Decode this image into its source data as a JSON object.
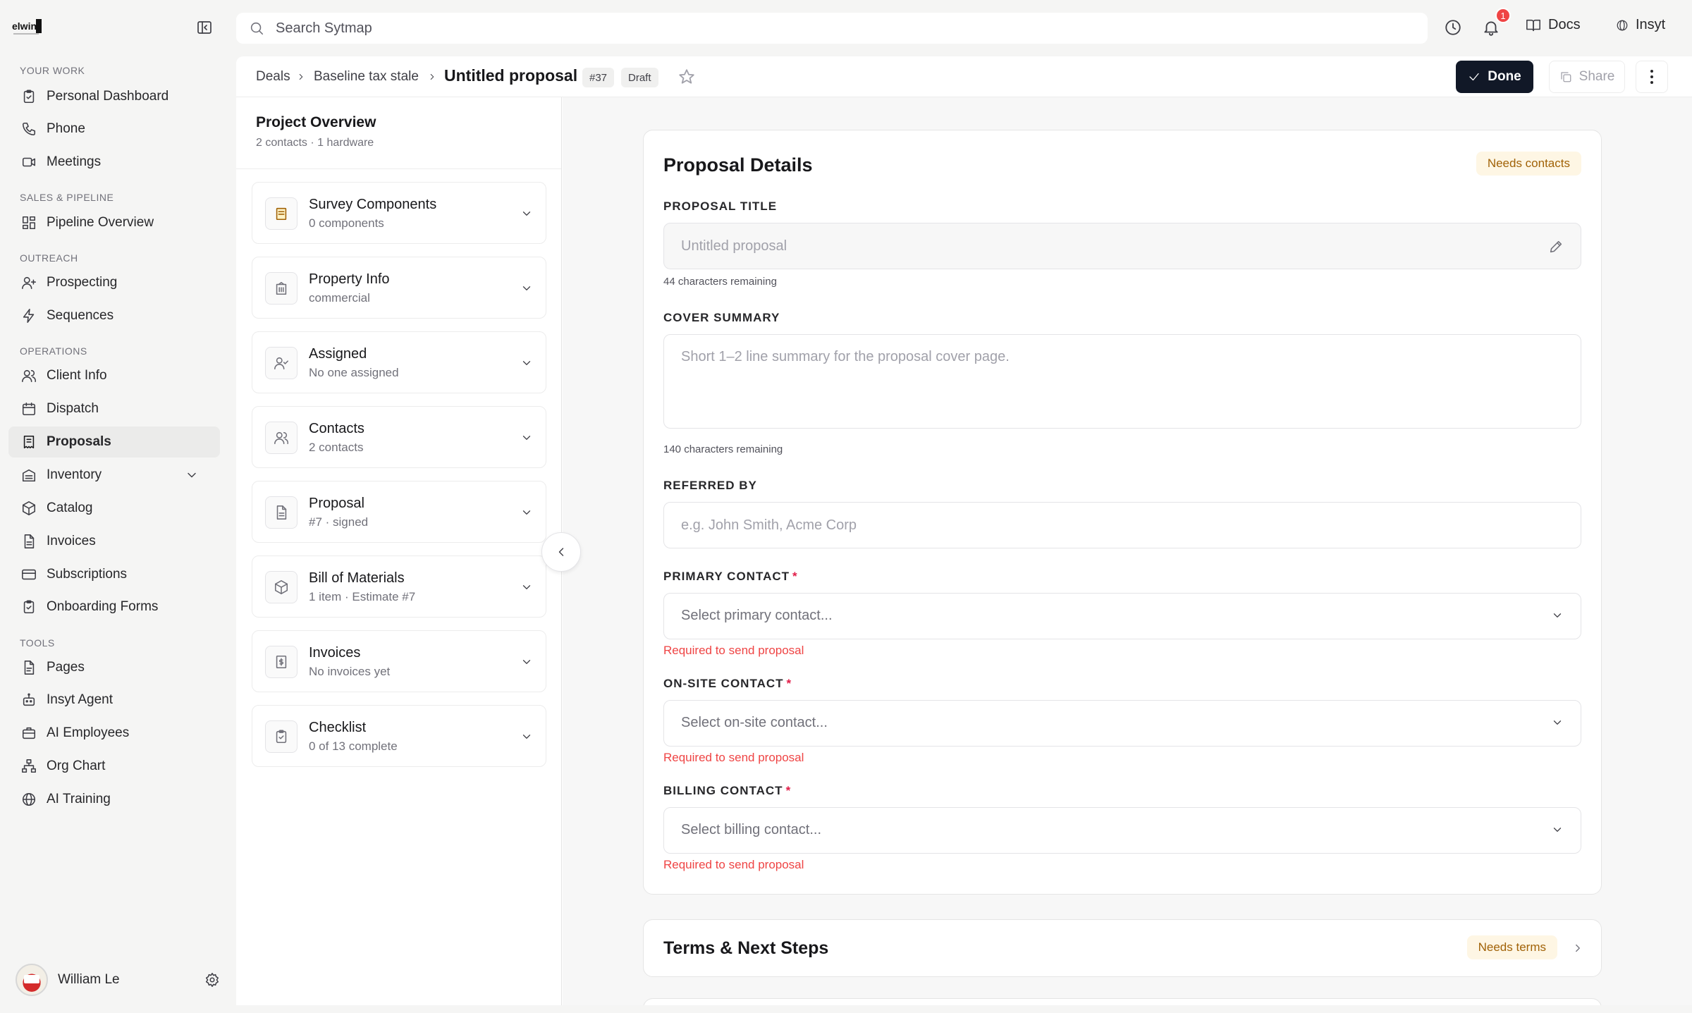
{
  "app": {
    "logo_text": "elwin"
  },
  "sidebar": {
    "sections": [
      {
        "label": "YOUR WORK"
      },
      {
        "label": "SALES & PIPELINE"
      },
      {
        "label": "OUTREACH"
      },
      {
        "label": "OPERATIONS"
      },
      {
        "label": "TOOLS"
      }
    ],
    "items": [
      {
        "label": "Personal Dashboard",
        "icon": "clipboard-icon"
      },
      {
        "label": "Phone",
        "icon": "phone-icon"
      },
      {
        "label": "Meetings",
        "icon": "video-icon"
      },
      {
        "label": "Pipeline Overview",
        "icon": "grid-icon"
      },
      {
        "label": "Prospecting",
        "icon": "user-plus-icon"
      },
      {
        "label": "Sequences",
        "icon": "lightning-icon"
      },
      {
        "label": "Client Info",
        "icon": "users-icon"
      },
      {
        "label": "Dispatch",
        "icon": "calendar-icon"
      },
      {
        "label": "Proposals",
        "icon": "receipt-icon"
      },
      {
        "label": "Inventory",
        "icon": "warehouse-icon"
      },
      {
        "label": "Catalog",
        "icon": "box-icon"
      },
      {
        "label": "Invoices",
        "icon": "document-icon"
      },
      {
        "label": "Subscriptions",
        "icon": "card-icon"
      },
      {
        "label": "Onboarding Forms",
        "icon": "clipboard-check-icon"
      },
      {
        "label": "Pages",
        "icon": "pages-icon"
      },
      {
        "label": "Insyt Agent",
        "icon": "robot-icon"
      },
      {
        "label": "AI Employees",
        "icon": "briefcase-icon"
      },
      {
        "label": "Org Chart",
        "icon": "org-chart-icon"
      },
      {
        "label": "AI Training",
        "icon": "globe-icon"
      }
    ],
    "active_item": "Proposals",
    "user": {
      "name": "William Le"
    }
  },
  "topbar": {
    "search_placeholder": "Search Sytmap",
    "notification_count": "1",
    "docs_label": "Docs",
    "insyt_label": "Insyt"
  },
  "header": {
    "breadcrumb": [
      "Deals",
      "Baseline tax stale"
    ],
    "title": "Untitled proposal",
    "number": "#37",
    "status": "Draft",
    "done_label": "Done",
    "share_label": "Share"
  },
  "panel": {
    "title": "Project Overview",
    "subtitle": "2 contacts · 1 hardware",
    "sections": [
      {
        "title": "Survey Components",
        "subtitle": "0 components",
        "icon": "survey-icon"
      },
      {
        "title": "Property Info",
        "subtitle": "commercial",
        "icon": "building-icon"
      },
      {
        "title": "Assigned",
        "subtitle": "No one assigned",
        "icon": "user-check-icon"
      },
      {
        "title": "Contacts",
        "subtitle": "2 contacts",
        "icon": "users-icon"
      },
      {
        "title": "Proposal",
        "subtitle": "#7 · signed",
        "icon": "document-icon"
      },
      {
        "title": "Bill of Materials",
        "subtitle": "1 item · Estimate #7",
        "icon": "package-icon"
      },
      {
        "title": "Invoices",
        "subtitle": "No invoices yet",
        "icon": "invoice-icon"
      },
      {
        "title": "Checklist",
        "subtitle": "0 of 13 complete",
        "icon": "checklist-icon"
      }
    ]
  },
  "form": {
    "title": "Proposal Details",
    "status_tag": "Needs contacts",
    "proposal_title": {
      "label": "PROPOSAL TITLE",
      "placeholder": "Untitled proposal",
      "hint": "44 characters remaining"
    },
    "cover_summary": {
      "label": "COVER SUMMARY",
      "placeholder": "Short 1–2 line summary for the proposal cover page.",
      "hint": "140 characters remaining"
    },
    "referred_by": {
      "label": "REFERRED BY",
      "placeholder": "e.g. John Smith, Acme Corp"
    },
    "primary_contact": {
      "label": "PRIMARY CONTACT",
      "required_mark": "*",
      "placeholder": "Select primary contact...",
      "error": "Required to send proposal"
    },
    "onsite_contact": {
      "label": "ON-SITE CONTACT",
      "required_mark": "*",
      "placeholder": "Select on-site contact...",
      "error": "Required to send proposal"
    },
    "billing_contact": {
      "label": "BILLING CONTACT",
      "required_mark": "*",
      "placeholder": "Select billing contact...",
      "error": "Required to send proposal"
    }
  },
  "terms": {
    "title": "Terms & Next Steps",
    "status_tag": "Needs terms"
  },
  "colors": {
    "primary_button": "#111827",
    "tag_bg": "#fef6e4",
    "tag_text": "#a16207",
    "error": "#ef4444",
    "notification": "#ef4444"
  }
}
